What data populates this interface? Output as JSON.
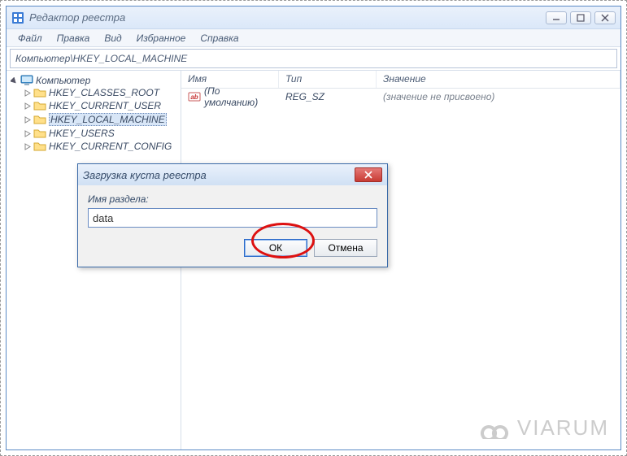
{
  "window": {
    "title": "Редактор реестра",
    "controls": {
      "minimize": "minimize",
      "maximize": "maximize",
      "close": "close"
    }
  },
  "menubar": {
    "items": [
      "Файл",
      "Правка",
      "Вид",
      "Избранное",
      "Справка"
    ]
  },
  "addressbar": {
    "path": "Компьютер\\HKEY_LOCAL_MACHINE"
  },
  "tree": {
    "root": {
      "label": "Компьютер",
      "icon": "computer-icon",
      "expanded": true,
      "children": [
        {
          "label": "HKEY_CLASSES_ROOT",
          "icon": "folder-icon"
        },
        {
          "label": "HKEY_CURRENT_USER",
          "icon": "folder-icon"
        },
        {
          "label": "HKEY_LOCAL_MACHINE",
          "icon": "folder-icon",
          "selected": true
        },
        {
          "label": "HKEY_USERS",
          "icon": "folder-icon"
        },
        {
          "label": "HKEY_CURRENT_CONFIG",
          "icon": "folder-icon"
        }
      ]
    }
  },
  "list": {
    "columns": {
      "name": "Имя",
      "type": "Тип",
      "value": "Значение"
    },
    "rows": [
      {
        "icon": "string-value-icon",
        "name": "(По умолчанию)",
        "type": "REG_SZ",
        "value": "(значение не присвоено)"
      }
    ]
  },
  "dialog": {
    "title": "Загрузка куста реестра",
    "label": "Имя раздела:",
    "input_value": "data",
    "ok": "ОК",
    "cancel": "Отмена"
  },
  "watermark": {
    "text": "VIARUM"
  }
}
